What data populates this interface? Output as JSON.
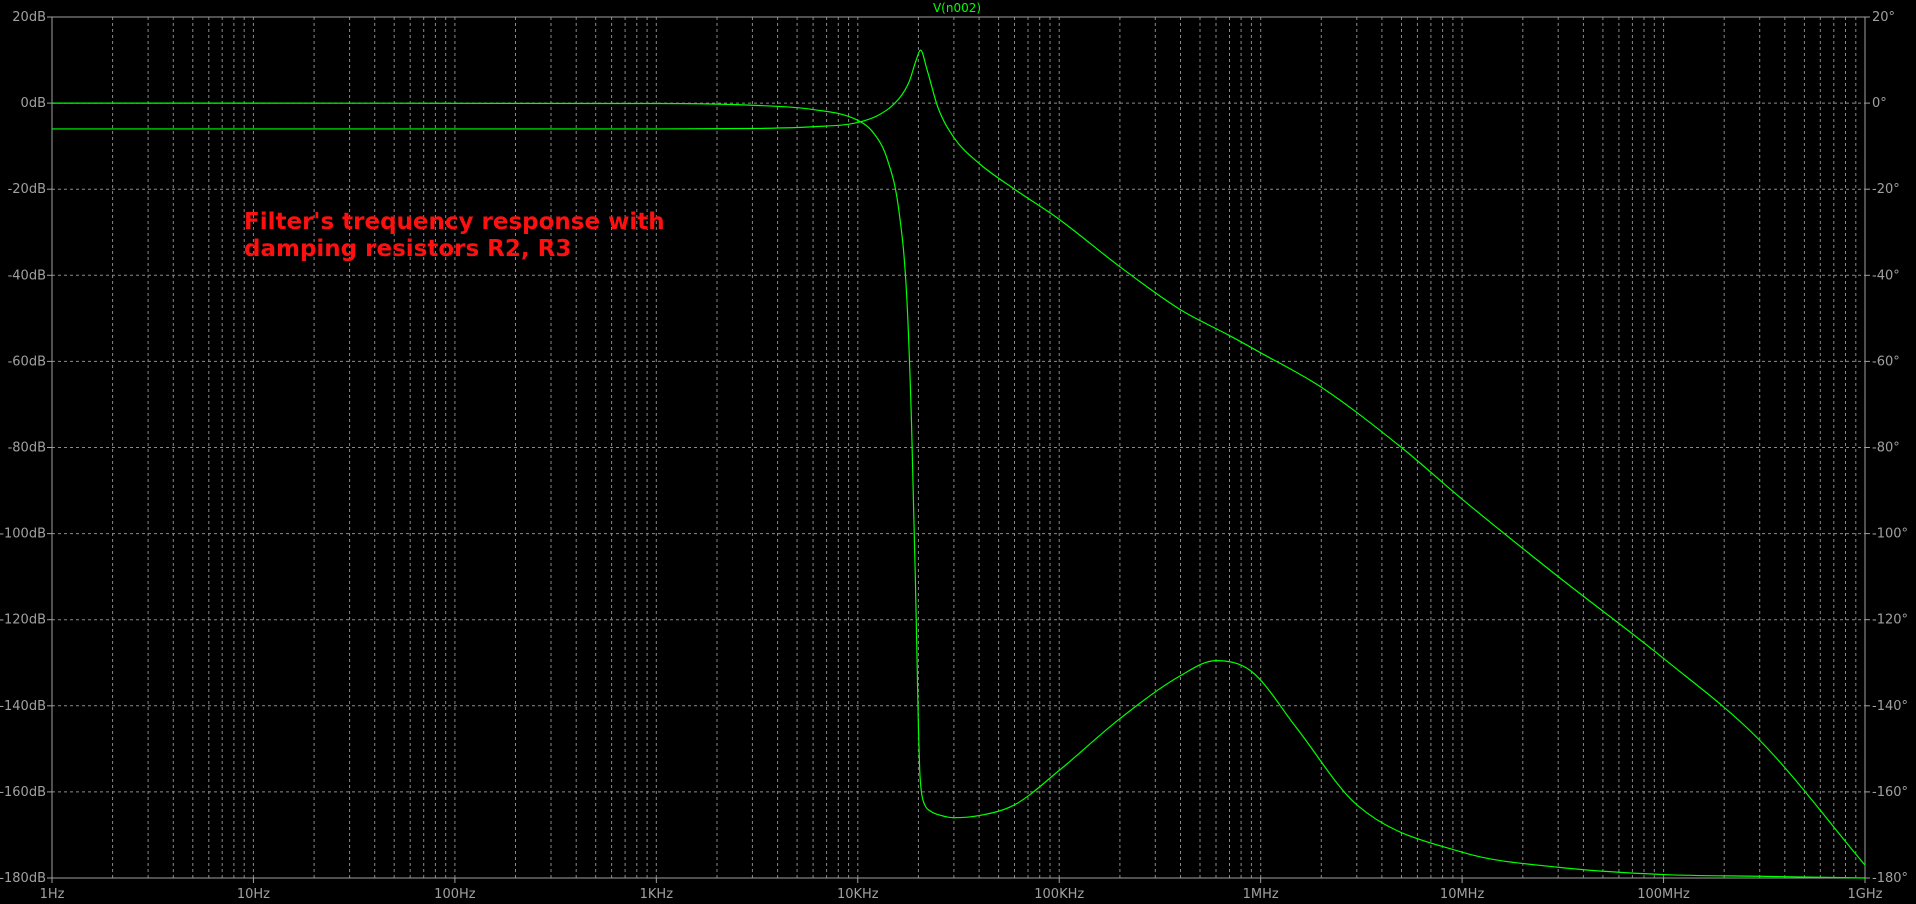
{
  "chart_data": {
    "type": "line",
    "title": "V(n002)",
    "x_scale": "log",
    "xlim": [
      1,
      1000000000
    ],
    "x_ticks": [
      {
        "value": 1,
        "label": "1Hz"
      },
      {
        "value": 10,
        "label": "10Hz"
      },
      {
        "value": 100,
        "label": "100Hz"
      },
      {
        "value": 1000,
        "label": "1KHz"
      },
      {
        "value": 10000,
        "label": "10KHz"
      },
      {
        "value": 100000,
        "label": "100KHz"
      },
      {
        "value": 1000000,
        "label": "1MHz"
      },
      {
        "value": 10000000,
        "label": "10MHz"
      },
      {
        "value": 100000000,
        "label": "100MHz"
      },
      {
        "value": 1000000000,
        "label": "1GHz"
      }
    ],
    "ylim": [
      -180,
      20
    ],
    "y_ticks": [
      {
        "value": 20,
        "label": "20dB"
      },
      {
        "value": 0,
        "label": "0dB"
      },
      {
        "value": -20,
        "label": "-20dB"
      },
      {
        "value": -40,
        "label": "-40dB"
      },
      {
        "value": -60,
        "label": "-60dB"
      },
      {
        "value": -80,
        "label": "-80dB"
      },
      {
        "value": -100,
        "label": "-100dB"
      },
      {
        "value": -120,
        "label": "-120dB"
      },
      {
        "value": -140,
        "label": "-140dB"
      },
      {
        "value": -160,
        "label": "-160dB"
      },
      {
        "value": -180,
        "label": "-180dB"
      }
    ],
    "y2lim": [
      -180,
      20
    ],
    "y2_ticks": [
      {
        "value": 20,
        "label": "20°"
      },
      {
        "value": 0,
        "label": "0°"
      },
      {
        "value": -20,
        "label": "-20°"
      },
      {
        "value": -40,
        "label": "-40°"
      },
      {
        "value": -60,
        "label": "-60°"
      },
      {
        "value": -80,
        "label": "-80°"
      },
      {
        "value": -100,
        "label": "-100°"
      },
      {
        "value": -120,
        "label": "-120°"
      },
      {
        "value": -140,
        "label": "-140°"
      },
      {
        "value": -160,
        "label": "-160°"
      },
      {
        "value": -180,
        "label": "-180°"
      }
    ],
    "grid": true,
    "annotation_lines": [
      "Filter's trequency response with",
      "damping resistors R2, R3"
    ],
    "series": [
      {
        "unit": "dB",
        "color": "#00ff00",
        "x": [
          1,
          100,
          1000,
          3000,
          6000,
          10000,
          13000,
          16000,
          18000,
          19500,
          20500,
          22000,
          25000,
          30000,
          40000,
          60000,
          100000,
          200000,
          400000,
          700000,
          1000000,
          2000000,
          5000000,
          10000000,
          30000000,
          100000000,
          300000000,
          1000000000
        ],
        "y": [
          -6,
          -6,
          -6,
          -5.9,
          -5.5,
          -4.5,
          -2.5,
          1,
          5,
          10,
          12.3,
          8,
          -1,
          -8,
          -14,
          -20,
          -27,
          -38,
          -48,
          -54,
          -58,
          -66,
          -80,
          -92,
          -110,
          -129,
          -148,
          -177
        ]
      },
      {
        "unit": "deg",
        "color": "#00ff00",
        "x": [
          1,
          1000,
          3000,
          6000,
          10000,
          12000,
          14000,
          16000,
          17500,
          18500,
          19300,
          19700,
          20000,
          20300,
          20700,
          21500,
          23000,
          26000,
          30000,
          40000,
          60000,
          100000,
          200000,
          400000,
          600000,
          900000,
          1500000,
          3000000,
          10000000,
          30000000,
          100000000,
          300000000,
          1000000000
        ],
        "y": [
          0,
          -0.1,
          -0.5,
          -1.5,
          -4,
          -7,
          -13,
          -25,
          -45,
          -75,
          -110,
          -130,
          -145,
          -155,
          -160,
          -163,
          -164.5,
          -165.5,
          -166,
          -165.5,
          -163,
          -155,
          -143,
          -133,
          -129.5,
          -132,
          -145,
          -163,
          -174,
          -177.5,
          -179.2,
          -179.6,
          -180
        ]
      }
    ]
  }
}
